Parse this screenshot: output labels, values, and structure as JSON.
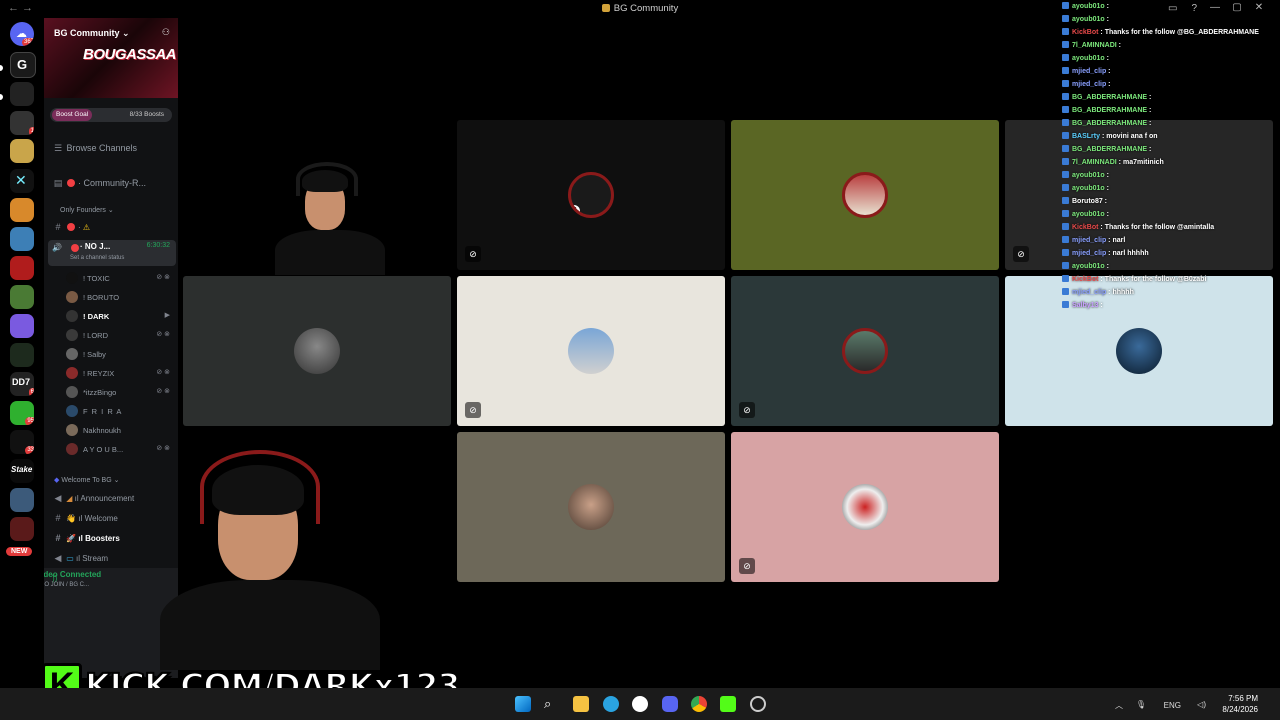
{
  "window": {
    "title": "BG Community",
    "controls": [
      "—",
      "▢",
      "✕"
    ]
  },
  "rail": {
    "dm_badge": "367",
    "badges": [
      "1",
      "6",
      "95",
      "33"
    ],
    "new_label": "NEW"
  },
  "sidebar": {
    "server_name": "BG Community",
    "banner_text": "BOUGASSAA",
    "boost_goal": "Boost Goal",
    "boost_count": "8/33 Boosts",
    "browse_channels": "Browse Channels",
    "community_channel": "Community-R...",
    "only_founders": "Only Founders",
    "voice_channel": "NO J...",
    "voice_timer": "6:30:32",
    "status_hint": "Set a channel status",
    "members": [
      "! TOXIC",
      "! BORUTO",
      "! DARK",
      "! LORD",
      "! Salby",
      "! REYZIX",
      "*itzzBingo",
      "F R I R A",
      "Nakhnoukh",
      "A Y O U B..."
    ],
    "category_welcome": "Welcome To BG",
    "channels": [
      "Announcement",
      "Welcome",
      "Boosters",
      "Stream"
    ],
    "video_connected": "Video Connected",
    "voice_location": "NO JOIN / BG C..."
  },
  "grid": {
    "colors": {
      "dark": "#0f0f0f",
      "olive": "#5a6624",
      "slate": "#2c2f2e",
      "cream": "#e8e5dd",
      "teal": "#2b3839",
      "skyblue": "#cfe3ea",
      "taupe": "#6d6859",
      "pink": "#d7a3a4"
    }
  },
  "chat": {
    "lines": [
      {
        "user": "ayoub01o",
        "color": "#7ce87c",
        "msg": ""
      },
      {
        "user": "ayoub01o",
        "color": "#7ce87c",
        "msg": ""
      },
      {
        "user": "KickBot",
        "color": "#e84a4a",
        "msg": "Thanks for the follow @BG_ABDERRAHMANE"
      },
      {
        "user": "7l_AMINNADI",
        "color": "#7ce87c",
        "msg": ""
      },
      {
        "user": "ayoub01o",
        "color": "#7ce87c",
        "msg": ""
      },
      {
        "user": "mjied_clip",
        "color": "#8aa0ff",
        "msg": ""
      },
      {
        "user": "mjied_clip",
        "color": "#8aa0ff",
        "msg": ""
      },
      {
        "user": "BG_ABDERRAHMANE",
        "color": "#7ce87c",
        "msg": ""
      },
      {
        "user": "BG_ABDERRAHMANE",
        "color": "#7ce87c",
        "msg": ""
      },
      {
        "user": "BG_ABDERRAHMANE",
        "color": "#7ce87c",
        "msg": ""
      },
      {
        "user": "BASLrty",
        "color": "#5bd0ff",
        "msg": "movini ana f on"
      },
      {
        "user": "BG_ABDERRAHMANE",
        "color": "#7ce87c",
        "msg": ""
      },
      {
        "user": "7l_AMINNADI",
        "color": "#7ce87c",
        "msg": "ma7mitinich"
      },
      {
        "user": "ayoub01o",
        "color": "#7ce87c",
        "msg": ""
      },
      {
        "user": "ayoub01o",
        "color": "#7ce87c",
        "msg": ""
      },
      {
        "user": "Boruto87",
        "color": "#ffffff",
        "msg": ""
      },
      {
        "user": "ayoub01o",
        "color": "#7ce87c",
        "msg": ""
      },
      {
        "user": "KickBot",
        "color": "#e84a4a",
        "msg": "Thanks for the follow @amintalla"
      },
      {
        "user": "mjied_clip",
        "color": "#8aa0ff",
        "msg": "narl"
      },
      {
        "user": "mjied_clip",
        "color": "#8aa0ff",
        "msg": "narl hhhhh"
      },
      {
        "user": "ayoub01o",
        "color": "#7ce87c",
        "msg": ""
      },
      {
        "user": "KickBot",
        "color": "#e84a4a",
        "msg": "Thanks for the follow @B0zabi"
      },
      {
        "user": "mjied_clip",
        "color": "#8aa0ff",
        "msg": "hhhhh"
      },
      {
        "user": "Salby13",
        "color": "#c9a0ff",
        "msg": ""
      }
    ]
  },
  "overlay": {
    "kick_letter": "K",
    "kick_text": "KICK.COM/DARKx123"
  },
  "taskbar": {
    "lang": "ENG",
    "time": "7:56 PM",
    "date": "8/24/2026"
  }
}
